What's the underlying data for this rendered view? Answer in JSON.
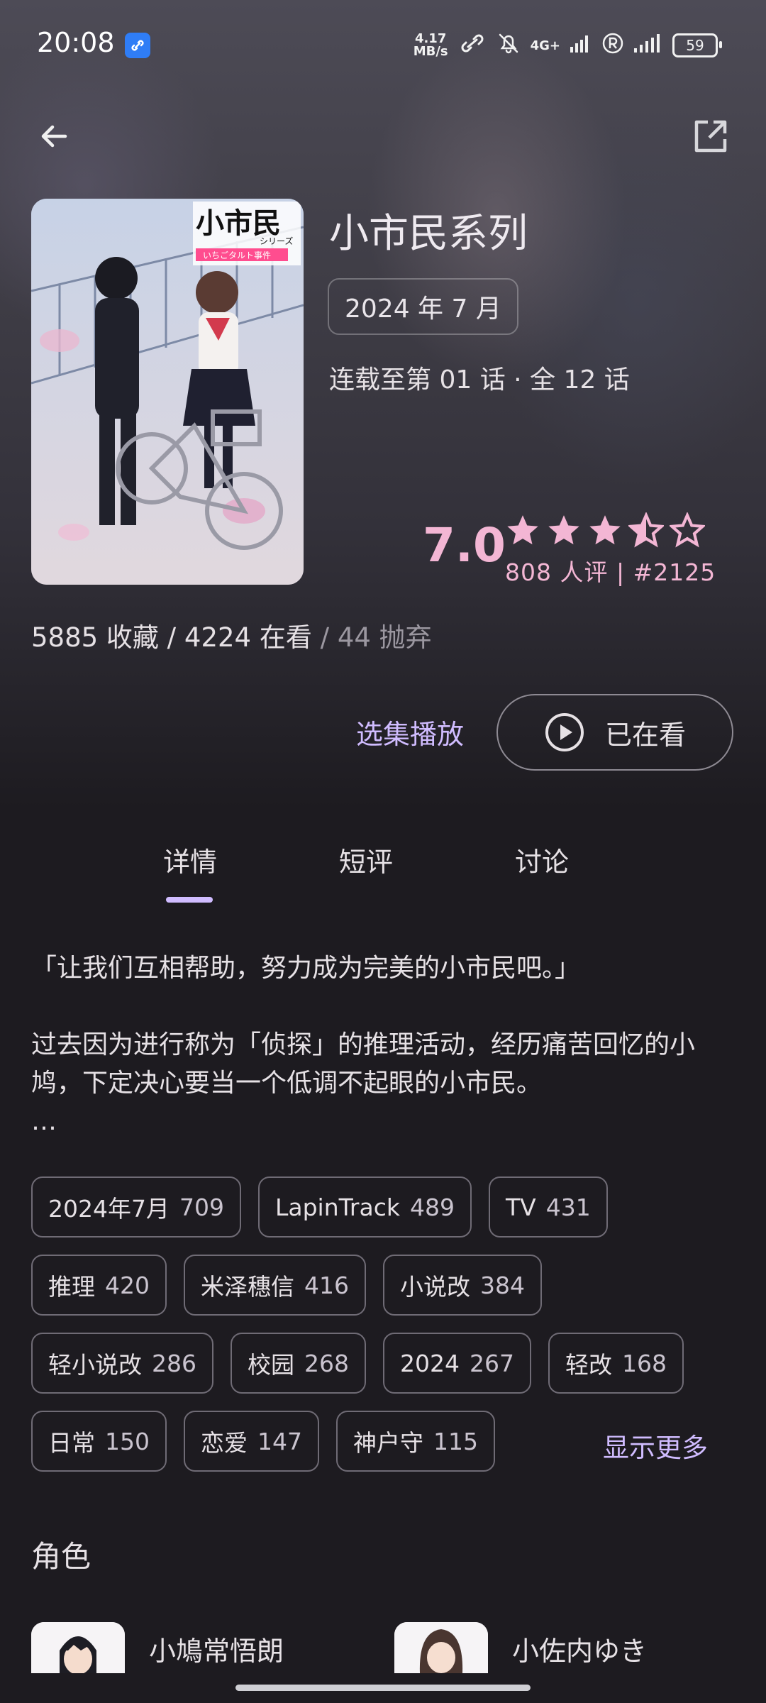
{
  "status_bar": {
    "time": "20:08",
    "net_speed_value": "4.17",
    "net_speed_unit": "MB/s",
    "network": "4G+",
    "battery": "59",
    "icons": [
      "link-icon",
      "mute-icon",
      "signal-icon",
      "roaming-r-icon",
      "signal-icon-2",
      "battery-icon"
    ]
  },
  "header": {
    "back_icon": "arrow-left-icon",
    "open_icon": "open-external-icon"
  },
  "anime": {
    "title": "小市民系列",
    "date": "2024 年 7 月",
    "episodes": "连载至第 01 话 · 全 12 话",
    "poster": {
      "logo_text": "小市民",
      "logo_series": "シリーズ",
      "logo_sub": "いちごタルト事件"
    },
    "score": "7.0",
    "stars": 3.5,
    "rating_meta": "808 人评 | #2125",
    "collect": "5885 收藏 / 4224 在看",
    "collect_dim": " / 44 抛弃"
  },
  "actions": {
    "select_episode": "选集播放",
    "watching": "已在看"
  },
  "tabs": [
    {
      "label": "详情",
      "active": true
    },
    {
      "label": "短评",
      "active": false
    },
    {
      "label": "讨论",
      "active": false
    }
  ],
  "summary": {
    "quote": "「让我们互相帮助，努力成为完美的小市民吧。」",
    "body": "过去因为进行称为「侦探」的推理活动，经历痛苦回忆的小鸠，下定决心要当一个低调不起眼的小市民。",
    "ellipsis": "…"
  },
  "tags": [
    [
      {
        "name": "2024年7月",
        "count": "709"
      },
      {
        "name": "LapinTrack",
        "count": "489"
      },
      {
        "name": "TV",
        "count": "431"
      }
    ],
    [
      {
        "name": "推理",
        "count": "420"
      },
      {
        "name": "米泽穗信",
        "count": "416"
      },
      {
        "name": "小说改",
        "count": "384"
      }
    ],
    [
      {
        "name": "轻小说改",
        "count": "286"
      },
      {
        "name": "校园",
        "count": "268"
      },
      {
        "name": "2024",
        "count": "267"
      },
      {
        "name": "轻改",
        "count": "168"
      }
    ],
    [
      {
        "name": "日常",
        "count": "150"
      },
      {
        "name": "恋爱",
        "count": "147"
      },
      {
        "name": "神户守",
        "count": "115"
      }
    ]
  ],
  "show_more": "显示更多",
  "characters_section": {
    "title": "角色",
    "items": [
      {
        "name": "小鳩常悟朗"
      },
      {
        "name": "小佐内ゆき"
      }
    ]
  },
  "colors": {
    "accent": "#d0bcff",
    "score": "#f3b6d4",
    "background": "#1d1b20"
  }
}
